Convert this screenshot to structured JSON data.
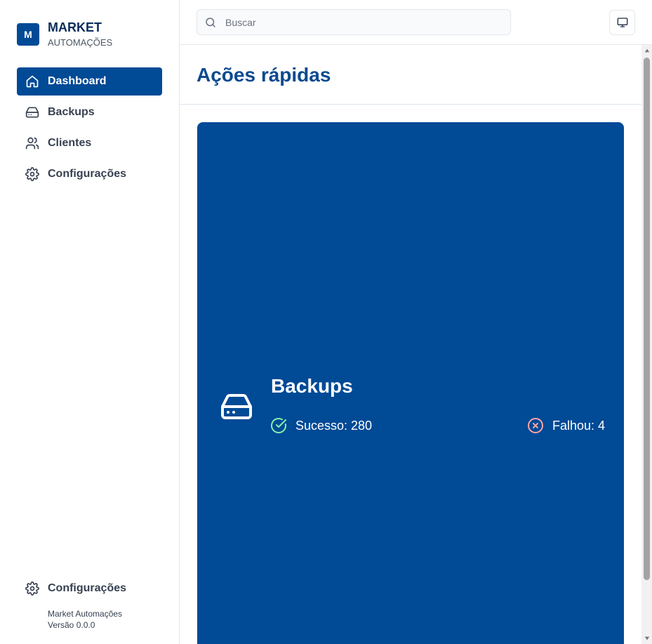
{
  "brand": {
    "logo_letter": "M",
    "name": "MARKET",
    "subtitle": "AUTOMAÇÕES"
  },
  "sidebar": {
    "items": [
      {
        "label": "Dashboard",
        "icon": "home-icon",
        "active": true
      },
      {
        "label": "Backups",
        "icon": "hard-drive-icon",
        "active": false
      },
      {
        "label": "Clientes",
        "icon": "users-icon",
        "active": false
      },
      {
        "label": "Configurações",
        "icon": "gear-icon",
        "active": false
      }
    ],
    "footer": {
      "settings_label": "Configurações",
      "app_name": "Market Automações",
      "version": "Versão 0.0.0"
    }
  },
  "search": {
    "placeholder": "Buscar",
    "value": ""
  },
  "toolbar": {
    "display_icon": "monitor-icon"
  },
  "main": {
    "title": "Ações rápidas",
    "card": {
      "title": "Backups",
      "success_label": "Sucesso: 280",
      "fail_label": "Falhou: 4"
    }
  },
  "colors": {
    "primary": "#004a96",
    "title": "#0b4a8f",
    "success": "#86efac",
    "failure": "#fca5a5"
  }
}
